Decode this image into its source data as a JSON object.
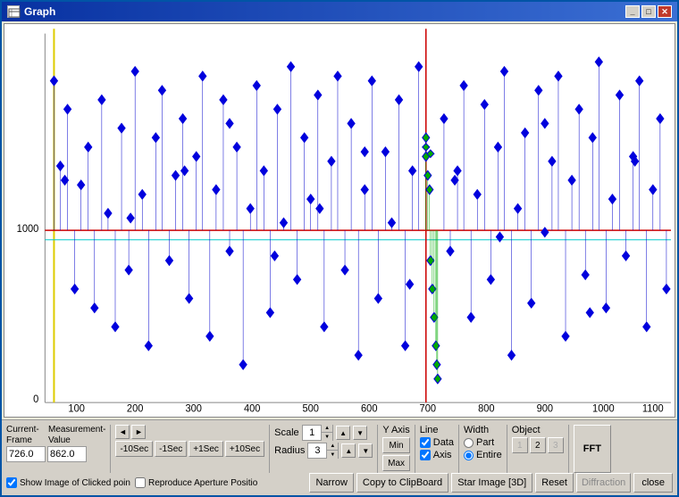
{
  "window": {
    "title": "Graph",
    "min_label": "_",
    "max_label": "□",
    "close_label": "✕"
  },
  "controls": {
    "current_frame_label": "Current-",
    "frame_label": "Frame",
    "measurement_label": "Measurement-",
    "value_label": "Value",
    "current_frame_value": "726.0",
    "measurement_value": "862.0",
    "nav_left": "◄",
    "nav_right": "►",
    "minus10": "-10Sec",
    "minus1": "-1Sec",
    "plus1": "+1Sec",
    "plus10": "+10Sec",
    "scale_label": "Scale",
    "scale_value": "1",
    "radius_label": "Radius",
    "radius_value": "3",
    "yaxis_label": "Y Axis",
    "yaxis_min": "Min",
    "yaxis_max": "Max",
    "line_label": "Line",
    "data_label": "Data",
    "axis_label": "Axis",
    "width_label": "Width",
    "part_label": "Part",
    "entire_label": "Entire",
    "object_label": "Object",
    "obj1": "1",
    "obj2": "2",
    "obj3": "3",
    "fft_label": "FFT",
    "show_image_label": "Show Image of Clicked poin",
    "reproduce_aperture_label": "Reproduce Aperture Positio",
    "narrow_label": "Narrow",
    "copy_clipboard_label": "Copy to ClipBoard",
    "star_image_label": "Star Image [3D]",
    "reset_label": "Reset",
    "diffraction_label": "Diffraction",
    "close_label": "close"
  },
  "graph": {
    "y_label_1000": "1000",
    "y_label_0": "0",
    "x_labels": [
      "100",
      "200",
      "300",
      "400",
      "500",
      "600",
      "700",
      "800",
      "900",
      "1000",
      "1100"
    ],
    "accent_color": "#0000ff",
    "green_color": "#00aa00",
    "red_line_color": "#cc0000",
    "yellow_line_color": "#ddcc00",
    "cyan_line_color": "#00cccc"
  }
}
